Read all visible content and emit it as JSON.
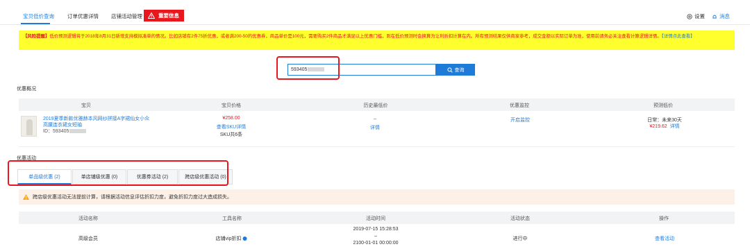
{
  "nav": {
    "tabs": [
      "宝贝低价查询",
      "订单优惠详情",
      "店铺活动管理"
    ],
    "alert_tab": "重要信息",
    "settings": "设置",
    "messages": "消息"
  },
  "warning": {
    "bold_prefix": "【风险提醒】",
    "text": "低价预测逻辑将于2018年8月31日新增支持模拟凑单的情况。比如店铺有2件75折优惠，或者满200-50的优惠券，商品单价是100元，需要购买2件商品才满足以上优惠门槛，则在低价预测时会换算为让利折扣计算在内。所有预测结果仅供商家参考，成交金额以实际订单为准，使用前请务必关注查看计算逻辑详情。",
    "link": "【详情点此查看】"
  },
  "search": {
    "value": "593405",
    "button": "查询"
  },
  "overview": {
    "title": "优惠概况",
    "headers": [
      "宝贝",
      "宝贝价格",
      "历史最低价",
      "优惠监控",
      "预测低价"
    ],
    "product": {
      "title_line1": "2019夏季新款优雅赫本风网纱拼接A字裙仙女小众",
      "title_line2": "高腰连衣裙女短袖",
      "id_label": "ID：",
      "id_value": "593405"
    },
    "price": "¥258.00",
    "sku_link": "查看SKU详情",
    "sku_count": "SKU共6条",
    "history_dash": "–",
    "history_link": "详情",
    "monitor_link": "开启监控",
    "predict_line1": "日常：未来30天",
    "predict_price": "¥219.62",
    "predict_link": "详情"
  },
  "activity": {
    "title": "优惠活动",
    "tabs": [
      "单品级优惠 (2)",
      "单店铺级优惠 (0)",
      "优惠券活动 (2)",
      "跨店级优惠活动 (0)"
    ],
    "notice": "跨店级优惠活动无法提前计算，请根据活动信息评估折扣力度，避免折扣力度过大造成损失。",
    "headers": [
      "活动名称",
      "工具名称",
      "活动时间",
      "活动状态",
      "操作"
    ],
    "row": {
      "name": "高级会员",
      "tool": "店铺vip折扣",
      "time_start": "2019-07-15 15:28:53",
      "time_dash": "–",
      "time_end": "2100-01-01 00:00:00",
      "status": "进行中",
      "action": "查看活动"
    }
  },
  "colors": {
    "accent": "#1f7bd8",
    "alert": "#e8161d",
    "warning_bg": "#ffff2e"
  }
}
